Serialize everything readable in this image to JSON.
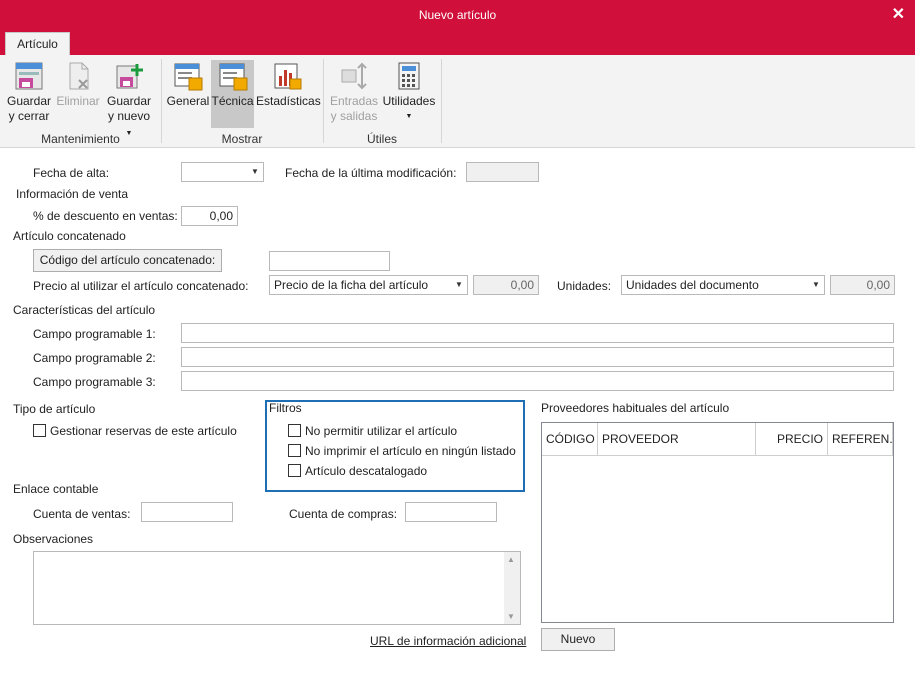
{
  "window": {
    "title": "Nuevo artículo"
  },
  "tab": {
    "label": "Artículo"
  },
  "ribbon": {
    "groups": {
      "mantenimiento": "Mantenimiento",
      "mostrar": "Mostrar",
      "utiles": "Útiles"
    },
    "guardar_cerrar": [
      "Guardar",
      "y cerrar"
    ],
    "eliminar": "Eliminar",
    "guardar_nuevo": [
      "Guardar",
      "y nuevo"
    ],
    "general": "General",
    "tecnica": "Técnica",
    "estadisticas": "Estadísticas",
    "entradas_salidas": [
      "Entradas",
      "y salidas"
    ],
    "utilidades": "Utilidades"
  },
  "form": {
    "fecha_alta_label": "Fecha de alta:",
    "fecha_alta_value": "",
    "fecha_mod_label": "Fecha de la última modificación:",
    "fecha_mod_value": "",
    "info_venta_heading": "Información de venta",
    "descuento_label": "% de descuento en ventas:",
    "descuento_value": "0,00",
    "concatenado_heading": "Artículo concatenado",
    "codigo_concatenado_button": "Código del artículo concatenado:",
    "codigo_concatenado_value": "",
    "precio_concatenado_label": "Precio al utilizar el artículo concatenado:",
    "precio_select_value": "Precio de la ficha del artículo",
    "precio_value": "0,00",
    "unidades_label": "Unidades:",
    "unidades_select_value": "Unidades del documento",
    "unidades_value": "0,00",
    "caracteristicas_heading": "Características del artículo",
    "campo1_label": "Campo programable 1:",
    "campo2_label": "Campo programable 2:",
    "campo3_label": "Campo programable 3:",
    "campo1_value": "",
    "campo2_value": "",
    "campo3_value": "",
    "tipo_heading": "Tipo de artículo",
    "reservas_label": "Gestionar reservas de este artículo",
    "filtros_heading": "Filtros",
    "filtro1_label": "No permitir utilizar el artículo",
    "filtro2_label": "No imprimir el artículo en ningún listado",
    "filtro3_label": "Artículo descatalogado",
    "proveedores_heading": "Proveedores habituales del artículo",
    "proveedores_columns": [
      "CÓDIGO",
      "PROVEEDOR",
      "PRECIO",
      "REFEREN..."
    ],
    "nuevo_button": "Nuevo",
    "enlace_heading": "Enlace contable",
    "cuenta_ventas_label": "Cuenta de ventas:",
    "cuenta_ventas_value": "",
    "cuenta_compras_label": "Cuenta de compras:",
    "cuenta_compras_value": "",
    "observaciones_heading": "Observaciones",
    "url_link": "URL de información adicional"
  },
  "icons": {
    "guardar_cerrar": "save-close-icon",
    "eliminar": "delete-icon",
    "guardar_nuevo": "save-new-icon",
    "general": "general-view-icon",
    "tecnica": "technical-view-icon",
    "estadisticas": "statistics-icon",
    "entradas_salidas": "stock-in-out-icon",
    "utilidades": "calculator-icon"
  },
  "colors": {
    "titlebar": "#d0103a",
    "filtros_border": "#1e6eb4"
  }
}
